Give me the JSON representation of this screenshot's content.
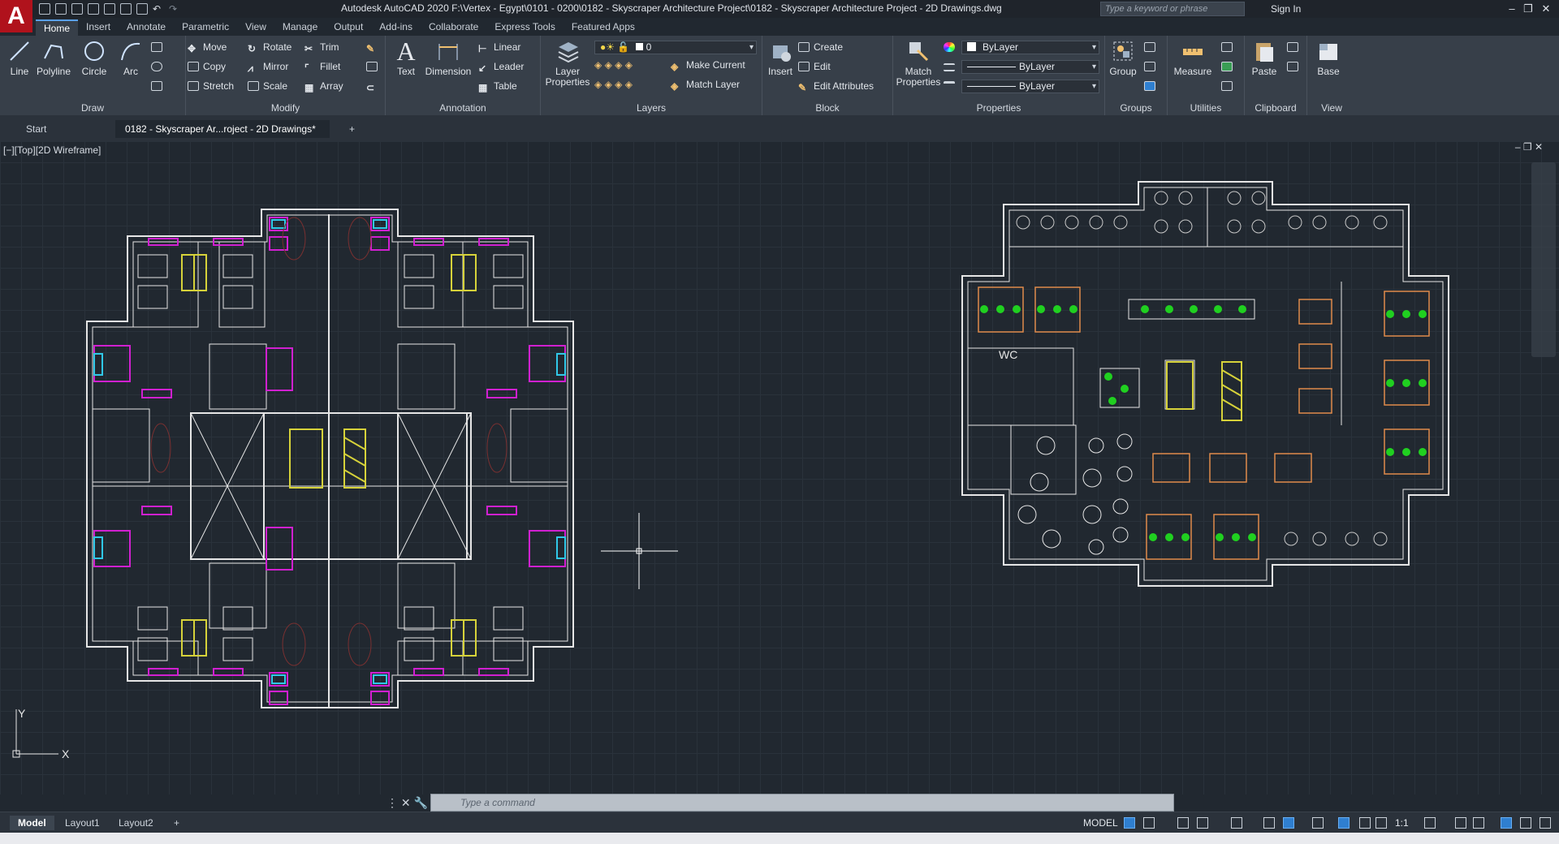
{
  "app": {
    "title": "Autodesk AutoCAD 2020    F:\\Vertex - Egypt\\0101 - 0200\\0182 - Skyscraper Architecture Project\\0182 - Skyscraper Architecture Project - 2D Drawings.dwg",
    "logo_letter": "A",
    "search_placeholder": "Type a keyword or phrase",
    "signin": "Sign In"
  },
  "menu_tabs": [
    "Home",
    "Insert",
    "Annotate",
    "Parametric",
    "View",
    "Manage",
    "Output",
    "Add-ins",
    "Collaborate",
    "Express Tools",
    "Featured Apps"
  ],
  "ribbon": {
    "draw": {
      "label": "Draw",
      "line": "Line",
      "polyline": "Polyline",
      "circle": "Circle",
      "arc": "Arc"
    },
    "modify": {
      "label": "Modify",
      "move": "Move",
      "rotate": "Rotate",
      "trim": "Trim",
      "copy": "Copy",
      "mirror": "Mirror",
      "fillet": "Fillet",
      "stretch": "Stretch",
      "scale": "Scale",
      "array": "Array"
    },
    "annotation": {
      "label": "Annotation",
      "text": "Text",
      "dimension": "Dimension",
      "linear": "Linear",
      "leader": "Leader",
      "table": "Table"
    },
    "layers": {
      "label": "Layers",
      "layer_properties": "Layer Properties",
      "current_layer": "0",
      "make_current": "Make Current",
      "match_layer": "Match Layer"
    },
    "block": {
      "label": "Block",
      "insert": "Insert",
      "create": "Create",
      "edit": "Edit",
      "edit_attributes": "Edit Attributes"
    },
    "properties": {
      "label": "Properties",
      "match_properties": "Match Properties",
      "color": "ByLayer",
      "linetype": "ByLayer",
      "lineweight": "ByLayer"
    },
    "groups": {
      "label": "Groups",
      "group": "Group"
    },
    "utilities": {
      "label": "Utilities",
      "measure": "Measure"
    },
    "clipboard": {
      "label": "Clipboard",
      "paste": "Paste"
    },
    "view": {
      "label": "View",
      "base": "Base"
    }
  },
  "doc_tabs": {
    "start": "Start",
    "current": "0182 - Skyscraper Ar...roject - 2D Drawings*"
  },
  "viewport_label": "[−][Top][2D Wireframe]",
  "ucs": {
    "x": "X",
    "y": "Y"
  },
  "drawing_labels": {
    "wc": "WC"
  },
  "command_placeholder": "Type a command",
  "layout_tabs": [
    "Model",
    "Layout1",
    "Layout2"
  ],
  "status": {
    "model": "MODEL",
    "scale": "1:1"
  },
  "colors": {
    "accent": "#2f7fd0",
    "magenta": "#d020d0",
    "yellow": "#d6d23a",
    "green": "#20d020",
    "cyan": "#30c8e8",
    "orange": "#e08a4a",
    "wall": "#e6e6e6",
    "grid": "#2a323b"
  }
}
